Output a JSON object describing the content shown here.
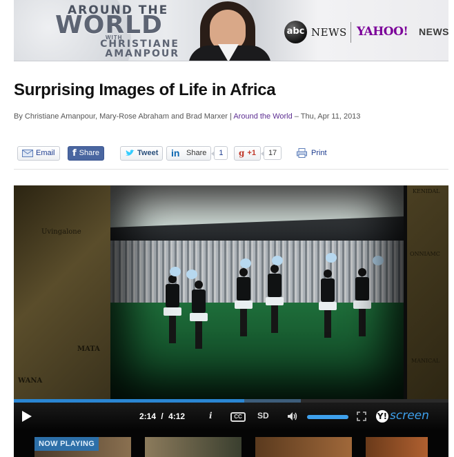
{
  "banner": {
    "line1": "AROUND THE",
    "line2": "WORLD",
    "line3": "WITH",
    "line4": "CHRISTIANE",
    "line5": "AMANPOUR",
    "abc_logo": "abc",
    "abc_news": "NEWS",
    "yahoo": "YAHOO!",
    "yahoo_news": "NEWS"
  },
  "article": {
    "title": "Surprising Images of Life in Africa",
    "byline_authors": "By Christiane Amanpour, Mary-Rose Abraham and Brad Marxer | ",
    "byline_section": "Around the World",
    "byline_date": " – Thu, Apr 11, 2013"
  },
  "share": {
    "email": "Email",
    "facebook": "Share",
    "twitter": "Tweet",
    "linkedin": "Share",
    "linkedin_count": "1",
    "gplus": "+1",
    "gplus_count": "17",
    "print": "Print"
  },
  "video": {
    "map_left_1": "Uvingalone",
    "map_left_2": "MATA",
    "map_left_3": "WANA",
    "map_right_1": "KENIDAL",
    "map_right_2": "ONNIAMC",
    "map_right_3": "MANICAL",
    "current_time": "2:14",
    "separator": "/",
    "duration": "4:12",
    "info_label": "i",
    "cc_label": "CC",
    "sd_label": "SD",
    "screen_brand": "screen",
    "progress_fraction": 0.53,
    "buffer_fraction": 0.66,
    "volume_fraction": 1.0,
    "now_playing": "NOW PLAYING"
  }
}
